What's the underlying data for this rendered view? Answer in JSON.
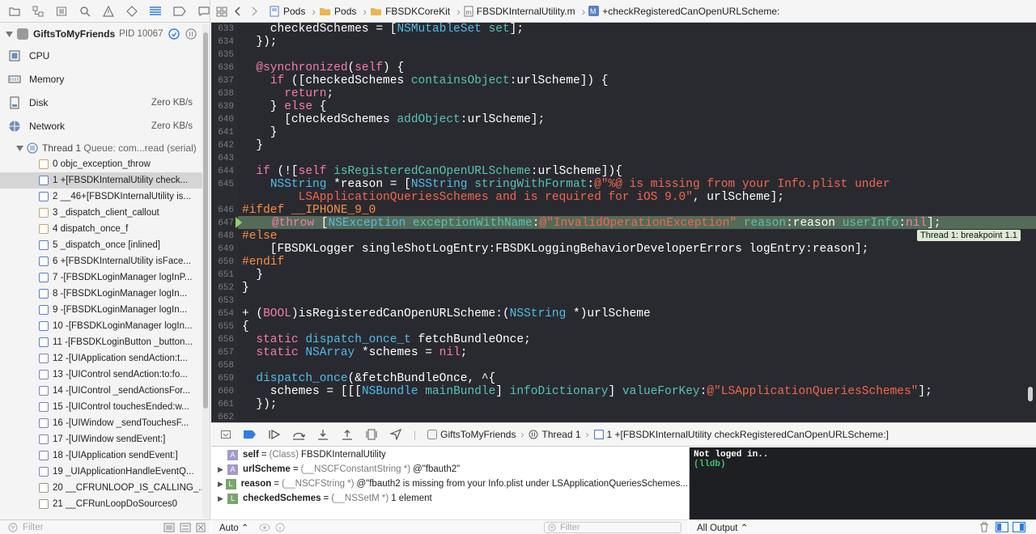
{
  "navigator": {
    "process_name": "GiftsToMyFriends",
    "pid": "PID 10067",
    "gauges": [
      {
        "label": "CPU",
        "value": ""
      },
      {
        "label": "Memory",
        "value": ""
      },
      {
        "label": "Disk",
        "value": "Zero KB/s"
      },
      {
        "label": "Network",
        "value": "Zero KB/s"
      }
    ],
    "thread_label": "Thread 1",
    "thread_queue": "Queue: com...read (serial)",
    "frames": [
      "0 objc_exception_throw",
      "1 +[FBSDKInternalUtility check...",
      "2 __46+[FBSDKInternalUtility is...",
      "3 _dispatch_client_callout",
      "4 dispatch_once_f",
      "5 _dispatch_once [inlined]",
      "6 +[FBSDKInternalUtility isFace...",
      "7 -[FBSDKLoginManager logInP...",
      "8 -[FBSDKLoginManager logIn...",
      "9 -[FBSDKLoginManager logIn...",
      "10 -[FBSDKLoginManager logIn...",
      "11 -[FBSDKLoginButton _button...",
      "12 -[UIApplication sendAction:t...",
      "13 -[UIControl sendAction:to:fo...",
      "14 -[UIControl _sendActionsFor...",
      "15 -[UIControl touchesEnded:w...",
      "16 -[UIWindow _sendTouchesF...",
      "17 -[UIWindow sendEvent:]",
      "18 -[UIApplication sendEvent:]",
      "19 _UIApplicationHandleEventQ...",
      "20 __CFRUNLOOP_IS_CALLING_...",
      "21 __CFRunLoopDoSources0"
    ],
    "filter_placeholder": "Filter"
  },
  "jumpbar": {
    "crumbs": [
      "Pods",
      "Pods",
      "FBSDKCoreKit",
      "FBSDKInternalUtility.m",
      "+checkRegisteredCanOpenURLScheme:"
    ]
  },
  "editor": {
    "line_numbers": [
      "633",
      "634",
      "635",
      "636",
      "637",
      "638",
      "639",
      "640",
      "641",
      "642",
      "643",
      "644",
      "645",
      "",
      "646",
      "647",
      "648",
      "649",
      "650",
      "651",
      "652",
      "653",
      "654",
      "655",
      "656",
      "657",
      "658",
      "659",
      "660",
      "661",
      "662"
    ],
    "breakpoint_label": "Thread 1: breakpoint 1.1"
  },
  "debugbar": {
    "crumbs": [
      "GiftsToMyFriends",
      "Thread 1",
      "1 +[FBSDKInternalUtility checkRegisteredCanOpenURLScheme:]"
    ]
  },
  "variables": [
    {
      "name": "self",
      "type": "(Class)",
      "value": "FBSDKInternalUtility",
      "kind": "A",
      "expandable": false
    },
    {
      "name": "urlScheme",
      "type": "(__NSCFConstantString *)",
      "value": "@\"fbauth2\"",
      "kind": "A",
      "expandable": true
    },
    {
      "name": "reason",
      "type": "(__NSCFString *)",
      "value": "@\"fbauth2 is missing from your Info.plist under LSApplicationQueriesSchemes...",
      "kind": "L",
      "expandable": true
    },
    {
      "name": "checkedSchemes",
      "type": "(__NSSetM *)",
      "value": "1 element",
      "kind": "L",
      "expandable": true
    }
  ],
  "variables_footer": {
    "mode": "Auto",
    "filter_placeholder": "Filter"
  },
  "console": {
    "line1": "Not loged in..",
    "line2": "(lldb)",
    "footer": "All Output"
  },
  "colors": {
    "editor_bg": "#292a30",
    "highlight": "#546b58",
    "keyword": "#f87ab0",
    "type": "#4fbde8",
    "string": "#f2664f"
  }
}
